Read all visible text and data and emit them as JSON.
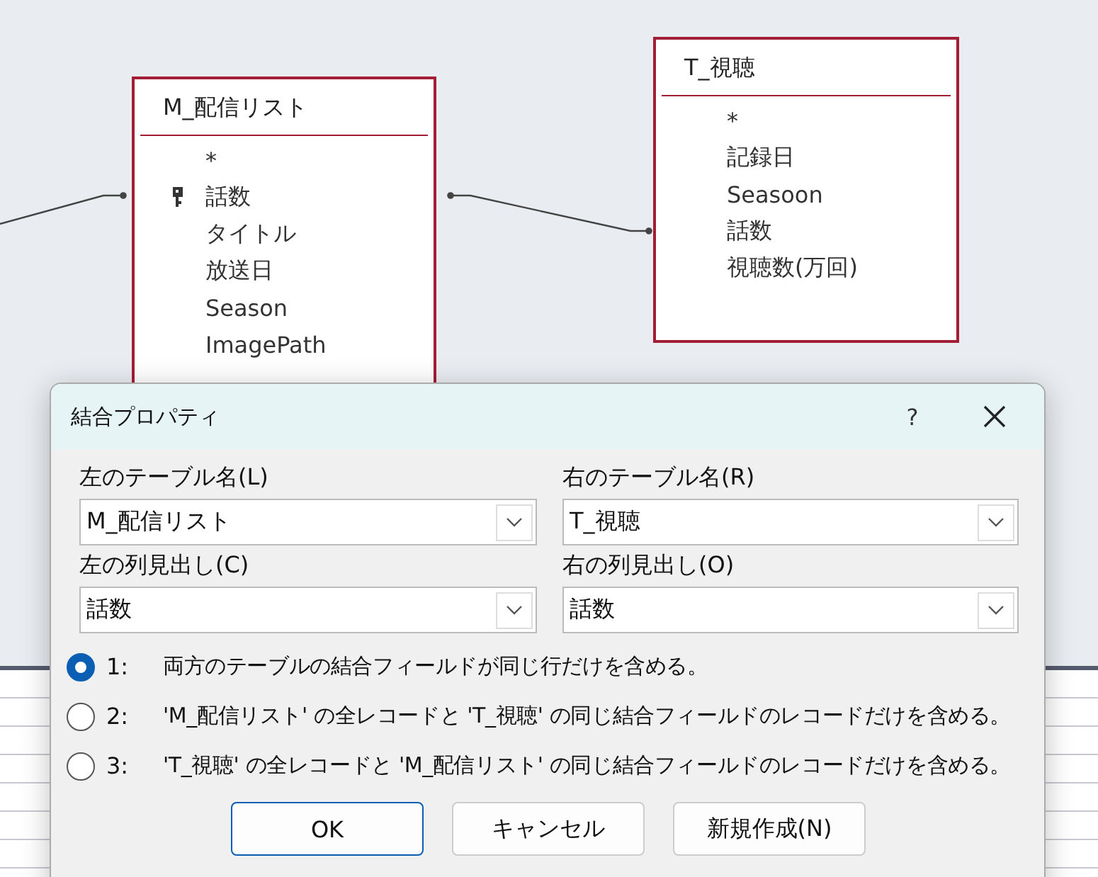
{
  "tables": [
    {
      "name": "M_配信リスト",
      "fields": [
        {
          "label": "*",
          "key": false
        },
        {
          "label": "話数",
          "key": true
        },
        {
          "label": "タイトル",
          "key": false
        },
        {
          "label": "放送日",
          "key": false
        },
        {
          "label": "Season",
          "key": false
        },
        {
          "label": "ImagePath",
          "key": false
        }
      ]
    },
    {
      "name": "T_視聴",
      "fields": [
        {
          "label": "*",
          "key": false
        },
        {
          "label": "記録日",
          "key": false
        },
        {
          "label": "Seasoon",
          "key": false
        },
        {
          "label": "話数",
          "key": false
        },
        {
          "label": "視聴数(万回)",
          "key": false
        }
      ]
    }
  ],
  "dialog": {
    "title": "結合プロパティ",
    "help": "?",
    "fields": [
      {
        "label": "左のテーブル名(L)",
        "value": "M_配信リスト"
      },
      {
        "label": "右のテーブル名(R)",
        "value": "T_視聴"
      },
      {
        "label": "左の列見出し(C)",
        "value": "話数"
      },
      {
        "label": "右の列見出し(O)",
        "value": "話数"
      }
    ],
    "options": [
      {
        "number": "1:",
        "text": "両方のテーブルの結合フィールドが同じ行だけを含める。",
        "selected": true
      },
      {
        "number": "2:",
        "text": "'M_配信リスト' の全レコードと 'T_視聴' の同じ結合フィールドのレコードだけを含める。",
        "selected": false
      },
      {
        "number": "3:",
        "text": "'T_視聴' の全レコードと 'M_配信リスト' の同じ結合フィールドのレコードだけを含める。",
        "selected": false
      }
    ],
    "buttons": [
      {
        "label": "OK",
        "default": true
      },
      {
        "label": "キャンセル",
        "default": false
      },
      {
        "label": "新規作成(N)",
        "default": false
      }
    ]
  }
}
